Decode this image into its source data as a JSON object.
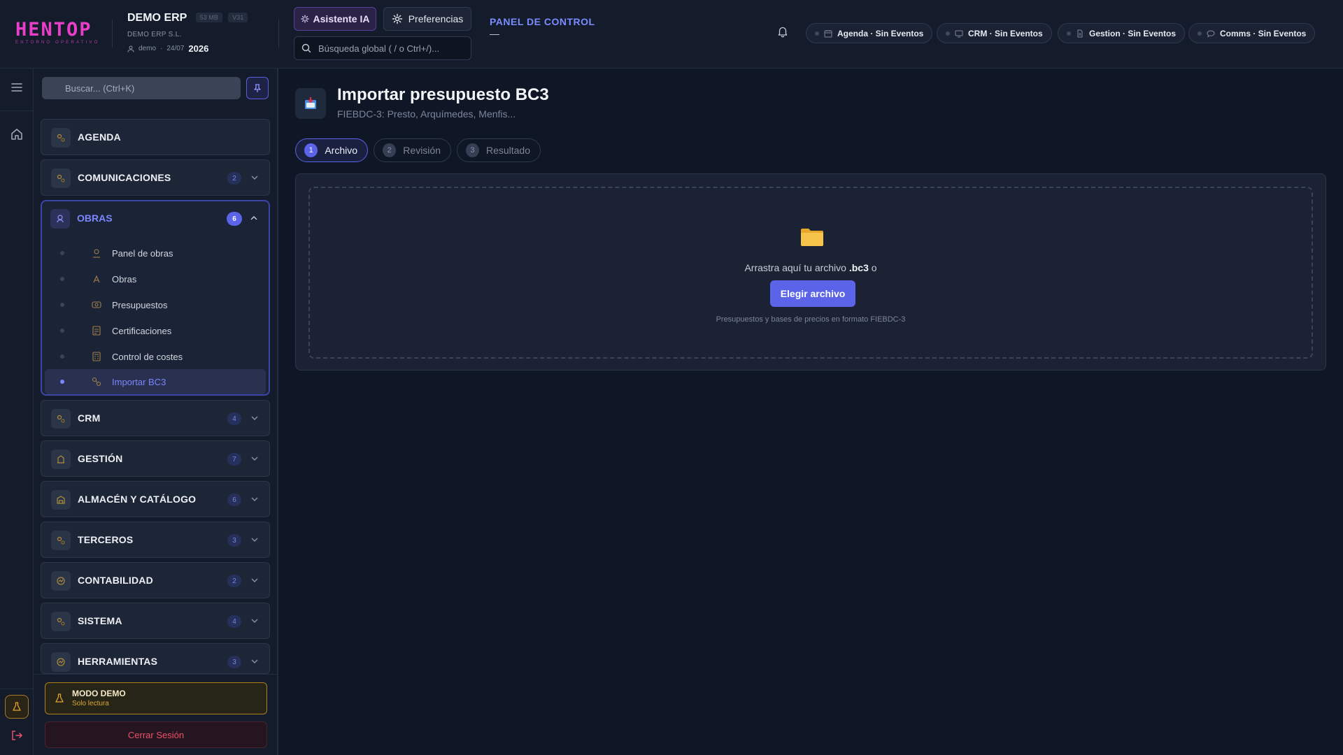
{
  "brand": {
    "logo_text": "HENTOP",
    "logo_tagline": "ENTORNO OPERATIVO"
  },
  "company": {
    "name": "DEMO ERP",
    "size_badge": "53 MB",
    "version_badge": "V31",
    "legal_name": "DEMO ERP S.L.",
    "user": "demo",
    "date": "24/07",
    "year": "2026"
  },
  "header": {
    "ai_label": "Asistente IA",
    "prefs_label": "Preferencias",
    "search_placeholder": "Búsqueda global ( / o Ctrl+/)...",
    "panel_title": "PANEL DE CONTROL",
    "panel_sub": "—",
    "status_chips": [
      {
        "label": "Agenda · Sin Eventos",
        "icon": "calendar-icon"
      },
      {
        "label": "CRM · Sin Eventos",
        "icon": "monitor-icon"
      },
      {
        "label": "Gestion · Sin Eventos",
        "icon": "document-icon"
      },
      {
        "label": "Comms · Sin Eventos",
        "icon": "chat-icon"
      }
    ]
  },
  "sidebar": {
    "search_placeholder": "Buscar... (Ctrl+K)",
    "groups": [
      {
        "label": "AGENDA",
        "count": ""
      },
      {
        "label": "COMUNICACIONES",
        "count": "2"
      },
      {
        "label": "OBRAS",
        "count": "6",
        "expanded": true
      },
      {
        "label": "CRM",
        "count": "4"
      },
      {
        "label": "GESTIÓN",
        "count": "7"
      },
      {
        "label": "ALMACÉN Y CATÁLOGO",
        "count": "6"
      },
      {
        "label": "TERCEROS",
        "count": "3"
      },
      {
        "label": "CONTABILIDAD",
        "count": "2"
      },
      {
        "label": "SISTEMA",
        "count": "4"
      },
      {
        "label": "HERRAMIENTAS",
        "count": "3"
      }
    ],
    "obras_items": [
      {
        "label": "Panel de obras"
      },
      {
        "label": "Obras"
      },
      {
        "label": "Presupuestos"
      },
      {
        "label": "Certificaciones"
      },
      {
        "label": "Control de costes"
      },
      {
        "label": "Importar BC3",
        "active": true
      }
    ],
    "demo_title": "MODO DEMO",
    "demo_sub": "Solo lectura",
    "logout_label": "Cerrar Sesión"
  },
  "main": {
    "title": "Importar presupuesto BC3",
    "subtitle": "FIEBDC-3: Presto, Arquímedes, Menfis...",
    "steps": [
      {
        "num": "1",
        "label": "Archivo",
        "active": true
      },
      {
        "num": "2",
        "label": "Revisión"
      },
      {
        "num": "3",
        "label": "Resultado"
      }
    ],
    "drop_text_before": "Arrastra aquí tu archivo ",
    "drop_text_ext": ".bc3",
    "drop_text_after": " o",
    "choose_label": "Elegir archivo",
    "drop_hint": "Presupuestos y bases de precios en formato FIEBDC-3"
  },
  "colors": {
    "accent": "#5b63e8",
    "accent_text": "#7b86ff",
    "brand_magenta": "#e83ec8",
    "warning": "#e0a82e",
    "danger": "#f0506a",
    "background": "#0f1626"
  }
}
